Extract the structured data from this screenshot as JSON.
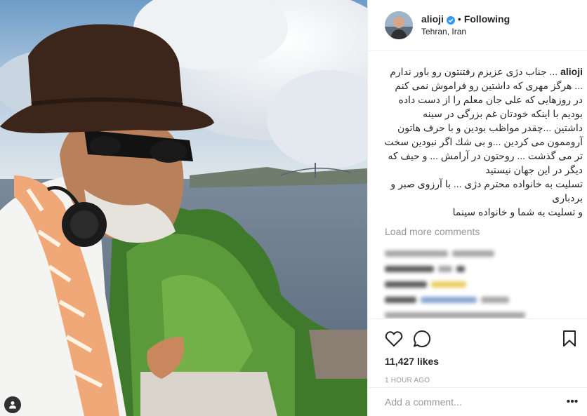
{
  "post": {
    "username": "alioji",
    "follow_status": "Following",
    "separator": "•",
    "location": "Tehran, Iran",
    "caption_user": "alioji",
    "caption_lines": [
      "... جناب دژی عزیزم رفتنتون رو باور ندارم",
      "... هرگز مهری که داشتین رو فراموش نمی کنم",
      "در روزهایی که علی جان معلم را از دست داده",
      "بودیم با اینکه خودتان غم بزرگی در سینه",
      "داشتین ...چقدر مواظب بودین و با حرف هاتون",
      "آروممون می کردین ...و بی شك اگر نبودین سخت",
      "تر می گذشت ... روحتون در آرامش ... و حیف که",
      "دیگر در این جهان نیستید",
      "تسلیت به خانواده محترم دژی ... با آرزوی صبر و",
      "بردباری",
      "و تسلیت به شما و خانواده سینما"
    ],
    "load_more": "Load more comments",
    "likes": "11,427 likes",
    "time": "1 HOUR AGO",
    "comment_placeholder": "Add a comment...",
    "more_icon": "•••"
  },
  "icons": {
    "verified": "verified-badge-icon",
    "like": "heart-icon",
    "comment": "comment-bubble-icon",
    "save": "bookmark-icon",
    "user_tag": "person-icon",
    "more": "more-options-icon"
  },
  "colors": {
    "verified": "#3897f0",
    "muted": "#999999",
    "text": "#262626",
    "border": "#efefef"
  }
}
